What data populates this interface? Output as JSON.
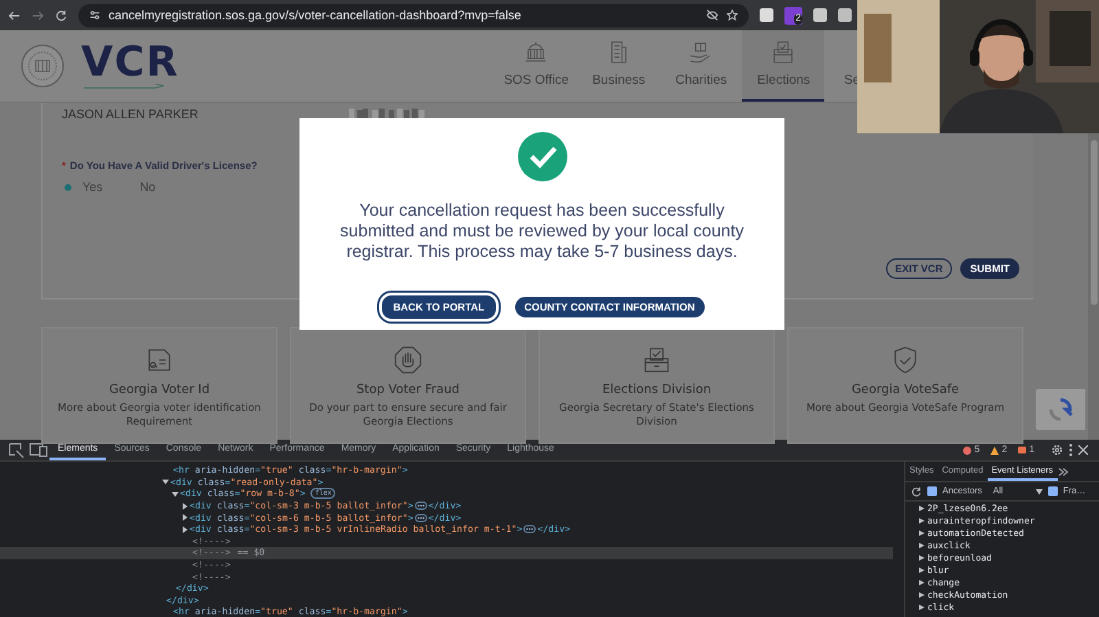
{
  "browser": {
    "url": "cancelmyregistration.sos.ga.gov/s/voter-cancellation-dashboard?mvp=false",
    "extension_badge": "2"
  },
  "header": {
    "logo": "VCR",
    "nav": [
      {
        "label": "SOS Office",
        "selected": false
      },
      {
        "label": "Business",
        "selected": false
      },
      {
        "label": "Charities",
        "selected": false
      },
      {
        "label": "Elections",
        "selected": true
      },
      {
        "label": "Se",
        "selected": false
      }
    ]
  },
  "form": {
    "voter_name": "JASON ALLEN PARKER",
    "question": {
      "required_mark": "*",
      "label": "Do You Have A Valid Driver's License?",
      "options": [
        {
          "label": "Yes",
          "selected": true
        },
        {
          "label": "No",
          "selected": false
        }
      ]
    },
    "buttons": [
      {
        "label": "EXIT VCR",
        "kind": "outline"
      },
      {
        "label": "SUBMIT",
        "kind": "filled"
      }
    ]
  },
  "info_cards": [
    {
      "title": "Georgia Voter Id",
      "description": "More about Georgia voter identification Requirement"
    },
    {
      "title": "Stop Voter Fraud",
      "description": "Do your part to ensure secure and fair Georgia Elections"
    },
    {
      "title": "Elections Division",
      "description": "Georgia Secretary of State's Elections Division"
    },
    {
      "title": "Georgia VoteSafe",
      "description": "More about Georgia VoteSafe Program"
    }
  ],
  "modal": {
    "message": "Your cancellation request has been successfully submitted and must be reviewed by your local county registrar. This process may take 5-7 business days.",
    "buttons": [
      {
        "label": "BACK TO PORTAL",
        "focused": true
      },
      {
        "label": "COUNTY CONTACT INFORMATION",
        "focused": false
      }
    ]
  },
  "devtools": {
    "tabs": [
      {
        "label": "Elements",
        "selected": true
      },
      {
        "label": "Sources",
        "selected": false
      },
      {
        "label": "Console",
        "selected": false
      },
      {
        "label": "Network",
        "selected": false
      },
      {
        "label": "Performance",
        "selected": false
      },
      {
        "label": "Memory",
        "selected": false
      },
      {
        "label": "Application",
        "selected": false
      },
      {
        "label": "Security",
        "selected": false
      },
      {
        "label": "Lighthouse",
        "selected": false
      }
    ],
    "counts": {
      "errors": "5",
      "warnings": "2",
      "issues": "1"
    },
    "dom_tree": [
      {
        "kind": "tag",
        "text": "<hr aria-hidden=\"true\" class=\"hr-b-margin\">",
        "selected": false
      },
      {
        "kind": "tag",
        "text": "<div class=\"read-only-data\">",
        "expanded": true,
        "close": "</div>",
        "selected": false,
        "children": [
          {
            "kind": "tag",
            "text": "<div class=\"row m-b-8\">",
            "badge": "flex",
            "expanded": true,
            "close": "</div>",
            "selected": false,
            "children": [
              {
                "kind": "tag",
                "text": "<div class=\"col-sm-3 m-b-5 ballot_infor\">",
                "expanded": false,
                "close": "</div>",
                "selected": false
              },
              {
                "kind": "tag",
                "text": "<div class=\"col-sm-6 m-b-5 ballot_infor\">",
                "expanded": false,
                "close": "</div>",
                "selected": false
              },
              {
                "kind": "tag",
                "text": "<div class=\"col-sm-3 m-b-5 vrInlineRadio ballot_infor m-t-1\">",
                "expanded": false,
                "close": "</div>",
                "selected": false
              },
              {
                "kind": "comment",
                "text": "<!---->",
                "selected": false
              },
              {
                "kind": "comment",
                "text": "<!---->",
                "selected": true,
                "suffix": "== $0"
              },
              {
                "kind": "comment",
                "text": "<!---->",
                "selected": false
              },
              {
                "kind": "comment",
                "text": "<!---->",
                "selected": false
              }
            ]
          }
        ]
      },
      {
        "kind": "tag",
        "text": "<hr aria-hidden=\"true\" class=\"hr-b-margin\">",
        "selected": false
      }
    ],
    "sidebar": {
      "tabs": [
        {
          "label": "Styles",
          "selected": false
        },
        {
          "label": "Computed",
          "selected": false
        },
        {
          "label": "Event Listeners",
          "selected": true
        }
      ],
      "ancestors": {
        "label": "Ancestors",
        "checked": true
      },
      "filter": "All",
      "framework": {
        "label": "Fra…",
        "checked": true
      },
      "listeners": [
        "2P_lzese0n6.2ee",
        "aurainteropfindowner",
        "automationDetected",
        "auxclick",
        "beforeunload",
        "blur",
        "change",
        "checkAutomation",
        "click"
      ]
    }
  }
}
